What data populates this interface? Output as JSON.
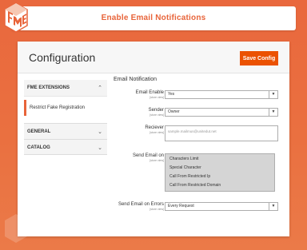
{
  "header": {
    "title": "Enable Email Notifications"
  },
  "colors": {
    "brand": "#e8643a",
    "save_button": "#eb5202"
  },
  "page": {
    "title": "Configuration",
    "save_label": "Save Config"
  },
  "sidebar": {
    "sections": [
      {
        "label": "FME EXTENSIONS",
        "expanded": true,
        "items": [
          "Restrict Fake Registration"
        ]
      },
      {
        "label": "GENERAL",
        "expanded": false
      },
      {
        "label": "CATALOG",
        "expanded": false
      }
    ]
  },
  "form": {
    "section_title": "Email Notification",
    "scope": "[store view]",
    "email_enable": {
      "label": "Email Enable",
      "value": "Yes"
    },
    "sender": {
      "label": "Sender",
      "value": "Owner"
    },
    "reciever": {
      "label": "Reciever",
      "value": "sample.mailmus@unitedut.net"
    },
    "send_email_on": {
      "label": "Send Email on",
      "options": [
        "Characters Limit",
        "Special Character",
        "Call From Restricted Ip",
        "Call From Restricted Domain"
      ]
    },
    "send_email_on_errors": {
      "label": "Send Email on Errors",
      "value": "Every Request"
    }
  }
}
